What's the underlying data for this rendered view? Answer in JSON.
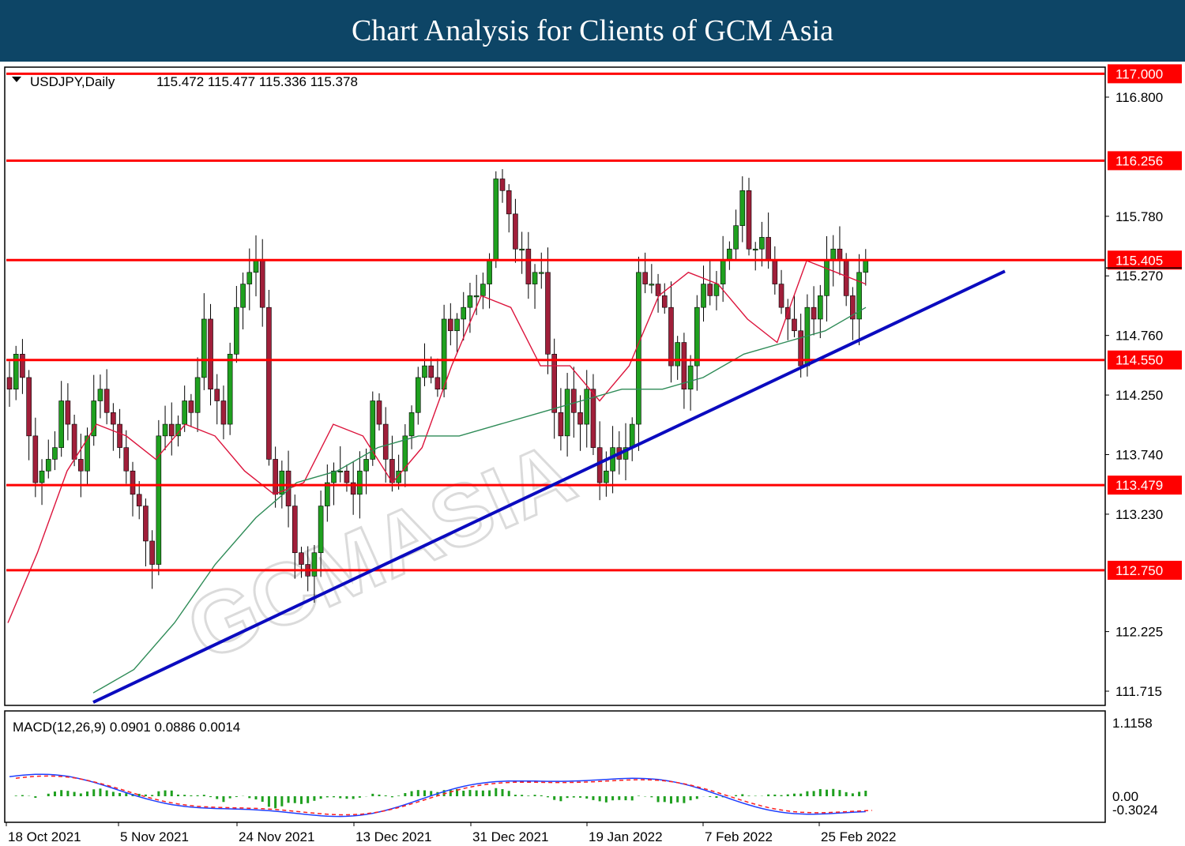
{
  "header": {
    "title": "Chart Analysis for Clients of GCM Asia"
  },
  "instrument": {
    "label": "USDJPY,Daily",
    "ohlc": "115.472 115.477 115.336 115.378"
  },
  "macd": {
    "label": "MACD(12,26,9) 0.0901 0.0886 0.0014",
    "axis_top": "1.1158",
    "axis_zero": "0.00",
    "axis_bottom": "-0.3024"
  },
  "colors": {
    "banner": "#0d4566",
    "level": "#ff0000",
    "trend": "#0b0bbf",
    "bull": "#1fa01f",
    "bear": "#a01f3a",
    "ma_fast": "#dc143c",
    "ma_slow": "#2e8b57"
  },
  "chart_data": {
    "type": "candlestick",
    "x_ticks": [
      "18 Oct 2021",
      "5 Nov 2021",
      "24 Nov 2021",
      "13 Dec 2021",
      "31 Dec 2021",
      "19 Jan 2022",
      "7 Feb 2022",
      "25 Feb 2022"
    ],
    "y_ticks": [
      "116.800",
      "115.780",
      "115.270",
      "114.760",
      "114.250",
      "113.740",
      "113.230",
      "112.225",
      "111.715"
    ],
    "ylim": [
      111.6,
      117.05
    ],
    "levels": [
      "117.000",
      "116.256",
      "115.405",
      "114.550",
      "113.479",
      "112.750"
    ],
    "close": [
      114.3,
      114.6,
      114.4,
      113.9,
      113.5,
      113.6,
      113.7,
      113.8,
      114.2,
      114.0,
      113.7,
      113.6,
      113.9,
      114.2,
      114.3,
      114.1,
      114.0,
      113.8,
      113.6,
      113.4,
      113.3,
      113.0,
      112.8,
      113.9,
      114.0,
      113.9,
      114.0,
      114.2,
      114.1,
      114.4,
      114.9,
      114.3,
      114.2,
      114.0,
      114.6,
      115.0,
      115.2,
      115.3,
      115.4,
      115.0,
      113.7,
      113.4,
      113.6,
      113.3,
      112.9,
      112.8,
      112.7,
      112.9,
      113.3,
      113.5,
      113.6,
      113.6,
      113.5,
      113.4,
      113.6,
      113.7,
      114.2,
      114.0,
      113.7,
      113.5,
      113.6,
      113.9,
      114.1,
      114.4,
      114.5,
      114.4,
      114.3,
      114.9,
      114.8,
      114.9,
      115.0,
      115.1,
      115.1,
      115.2,
      115.4,
      116.1,
      116.0,
      115.8,
      115.5,
      115.5,
      115.2,
      115.3,
      115.3,
      114.6,
      114.1,
      113.9,
      114.3,
      114.1,
      114.0,
      114.3,
      113.8,
      113.5,
      113.6,
      113.8,
      113.7,
      113.8,
      114.0,
      115.3,
      115.2,
      115.2,
      115.1,
      115.0,
      114.5,
      114.7,
      114.3,
      114.5,
      115.0,
      115.2,
      115.1,
      115.2,
      115.4,
      115.5,
      115.7,
      116.0,
      115.5,
      115.5,
      115.6,
      115.4,
      115.2,
      115.0,
      114.9,
      114.8,
      114.5,
      115.0,
      114.9,
      115.1,
      115.4,
      115.5,
      115.4,
      115.1,
      114.9,
      115.3,
      115.4
    ],
    "series": [
      {
        "type": "line",
        "values": [
          112.3,
          112.9,
          113.6,
          114.0,
          113.9,
          113.7,
          114.0,
          113.9,
          113.6,
          113.4,
          113.5,
          114.0,
          113.9,
          113.5,
          113.8,
          114.5,
          115.1,
          115.0,
          114.5,
          114.5,
          114.2,
          114.5,
          115.1,
          115.3,
          115.2,
          114.9,
          114.7,
          115.4,
          115.3,
          115.2
        ]
      },
      {
        "type": "line",
        "values": [
          111.7,
          111.9,
          112.3,
          112.8,
          113.2,
          113.5,
          113.6,
          113.8,
          113.9,
          113.9,
          114.0,
          114.1,
          114.2,
          114.3,
          114.3,
          114.4,
          114.6,
          114.7,
          114.8,
          115.0
        ]
      }
    ]
  }
}
